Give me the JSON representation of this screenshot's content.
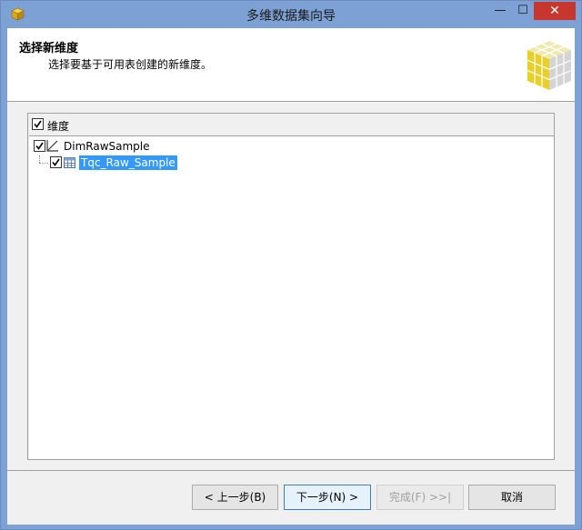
{
  "window": {
    "title": "多维数据集向导",
    "minimize_glyph": "—",
    "maximize_glyph": "☐",
    "close_glyph": "✕"
  },
  "header": {
    "title": "选择新维度",
    "description": "选择要基于可用表创建的新维度。",
    "graphic_icon": "cube-icon"
  },
  "dimension_list": {
    "column_header": "维度",
    "column_header_checked": true,
    "items": [
      {
        "label": "DimRawSample",
        "checked": true,
        "icon": "dimension-icon",
        "children": [
          {
            "label": "Tqc_Raw_Sample",
            "checked": true,
            "icon": "table-icon",
            "selected": true
          }
        ]
      }
    ]
  },
  "buttons": {
    "back": "< 上一步(B)",
    "next": "下一步(N) >",
    "finish": "完成(F) >>|",
    "cancel": "取消"
  },
  "colors": {
    "titlebar": "#7da1d4",
    "close_button": "#c7372f",
    "selection": "#3399ff",
    "client_bg": "#f0f0f0"
  }
}
